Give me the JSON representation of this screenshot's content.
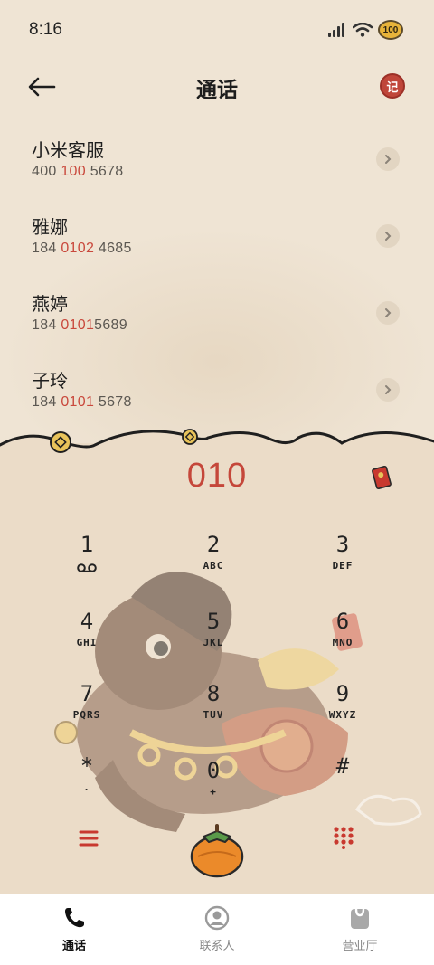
{
  "status_bar": {
    "time": "8:16",
    "battery_level": "100"
  },
  "header": {
    "title": "通话",
    "seal_glyph": "记"
  },
  "calls": [
    {
      "name": "小米客服",
      "number_parts": [
        "400 ",
        "100",
        " 5678"
      ]
    },
    {
      "name": "雅娜",
      "number_parts": [
        "184 ",
        "0102",
        " 4685"
      ]
    },
    {
      "name": "燕婷",
      "number_parts": [
        "184 ",
        "0101",
        "5689"
      ]
    },
    {
      "name": "子玲",
      "number_parts": [
        "184 ",
        "0101",
        " 5678"
      ]
    }
  ],
  "dialer": {
    "display": "010"
  },
  "keypad": [
    {
      "digit": "1",
      "letters": ""
    },
    {
      "digit": "2",
      "letters": "ABC"
    },
    {
      "digit": "3",
      "letters": "DEF"
    },
    {
      "digit": "4",
      "letters": "GHI"
    },
    {
      "digit": "5",
      "letters": "JKL"
    },
    {
      "digit": "6",
      "letters": "MNO"
    },
    {
      "digit": "7",
      "letters": "PQRS"
    },
    {
      "digit": "8",
      "letters": "TUV"
    },
    {
      "digit": "9",
      "letters": "WXYZ"
    },
    {
      "digit": "*",
      "letters": "."
    },
    {
      "digit": "0",
      "letters": "+"
    },
    {
      "digit": "#",
      "letters": ""
    }
  ],
  "nav": [
    {
      "label": "通话",
      "icon": "phone-icon",
      "active": true
    },
    {
      "label": "联系人",
      "icon": "contacts-icon",
      "active": false
    },
    {
      "label": "营业厅",
      "icon": "shopping-bag-icon",
      "active": false
    }
  ],
  "colors": {
    "accent": "#c5473a",
    "background": "#ebdcc8",
    "paper": "#efe4d4"
  }
}
